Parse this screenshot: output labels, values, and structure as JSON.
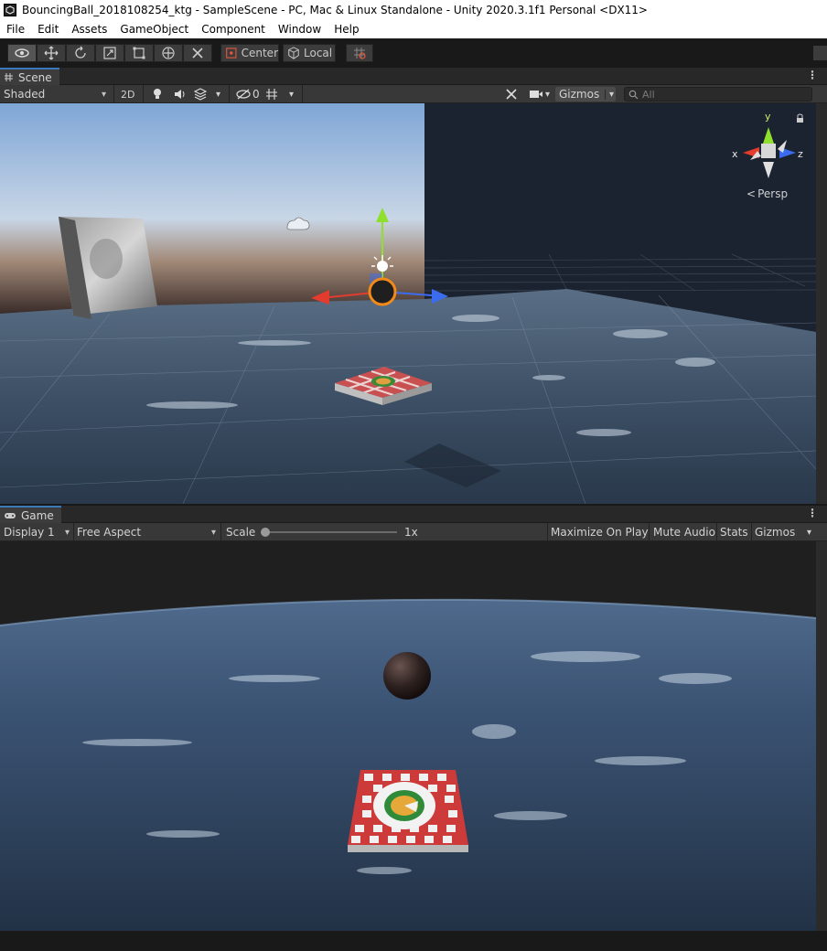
{
  "window": {
    "title": "BouncingBall_2018108254_ktg - SampleScene - PC, Mac & Linux Standalone - Unity 2020.3.1f1 Personal <DX11>"
  },
  "menu": [
    "File",
    "Edit",
    "Assets",
    "GameObject",
    "Component",
    "Window",
    "Help"
  ],
  "toolbar": {
    "tools": [
      "hand-tool",
      "move-tool",
      "rotate-tool",
      "scale-tool",
      "rect-tool",
      "transform-tool",
      "custom-tool"
    ],
    "pivot_label": "Center",
    "space_label": "Local"
  },
  "scene": {
    "tab_label": "Scene",
    "shading_mode": "Shaded",
    "toggle_2d": "2D",
    "hidden_count": "0",
    "gizmos_label": "Gizmos",
    "search_placeholder": "All",
    "axis_x": "x",
    "axis_y": "y",
    "axis_z": "z",
    "projection_label": "Persp"
  },
  "game": {
    "tab_label": "Game",
    "display": "Display 1",
    "aspect": "Free Aspect",
    "scale_label": "Scale",
    "scale_value": "1x",
    "maximize_label": "Maximize On Play",
    "mute_label": "Mute Audio",
    "stats_label": "Stats",
    "gizmos_label": "Gizmos"
  },
  "colors": {
    "accent": "#3a79bb",
    "x_axis": "#e33b2e",
    "y_axis": "#8ee02c",
    "z_axis": "#3b6cf0",
    "selection": "#f28a19"
  }
}
